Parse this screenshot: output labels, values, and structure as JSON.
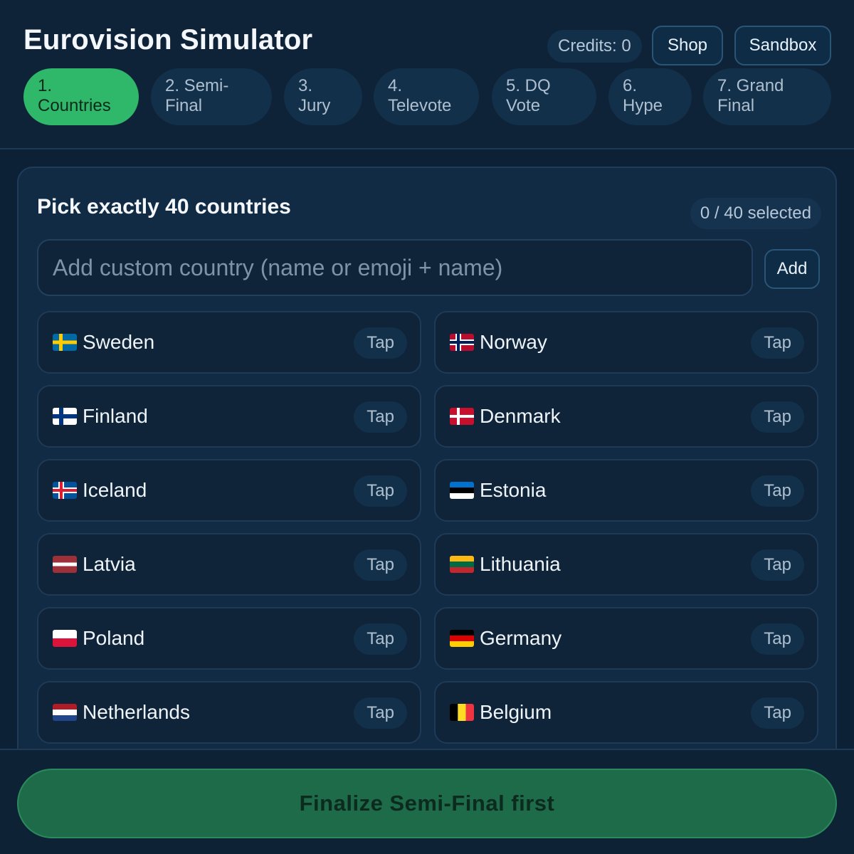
{
  "app": {
    "title": "Eurovision Simulator"
  },
  "header": {
    "credits": "Credits: 0",
    "shop_label": "Shop",
    "sandbox_label": "Sandbox"
  },
  "steps": [
    {
      "label": "1.\nCountries",
      "active": true
    },
    {
      "label": "2. Semi-\nFinal",
      "active": false
    },
    {
      "label": "3.\nJury",
      "active": false
    },
    {
      "label": "4.\nTelevote",
      "active": false
    },
    {
      "label": "5. DQ\nVote",
      "active": false
    },
    {
      "label": "6.\nHype",
      "active": false
    },
    {
      "label": "7. Grand\nFinal",
      "active": false
    }
  ],
  "panel": {
    "title": "Pick exactly 40 countries",
    "selected_count": "0 / 40 selected",
    "custom_placeholder": "Add custom country (name or emoji + name)",
    "custom_value": "",
    "add_label": "Add"
  },
  "countries": [
    {
      "name": "Sweden",
      "flag": "sweden-flag-icon",
      "tap": "Tap"
    },
    {
      "name": "Norway",
      "flag": "norway-flag-icon",
      "tap": "Tap"
    },
    {
      "name": "Finland",
      "flag": "finland-flag-icon",
      "tap": "Tap"
    },
    {
      "name": "Denmark",
      "flag": "denmark-flag-icon",
      "tap": "Tap"
    },
    {
      "name": "Iceland",
      "flag": "iceland-flag-icon",
      "tap": "Tap"
    },
    {
      "name": "Estonia",
      "flag": "estonia-flag-icon",
      "tap": "Tap"
    },
    {
      "name": "Latvia",
      "flag": "latvia-flag-icon",
      "tap": "Tap"
    },
    {
      "name": "Lithuania",
      "flag": "lithuania-flag-icon",
      "tap": "Tap"
    },
    {
      "name": "Poland",
      "flag": "poland-flag-icon",
      "tap": "Tap"
    },
    {
      "name": "Germany",
      "flag": "germany-flag-icon",
      "tap": "Tap"
    },
    {
      "name": "Netherlands",
      "flag": "netherlands-flag-icon",
      "tap": "Tap"
    },
    {
      "name": "Belgium",
      "flag": "belgium-flag-icon",
      "tap": "Tap"
    }
  ],
  "footer": {
    "finalize_label": "Finalize Semi-Final first"
  },
  "colors": {
    "background": "#0d2136",
    "panel": "#122b45",
    "accent_green": "#2fb86a",
    "finalize_green": "#1e6b4a"
  }
}
